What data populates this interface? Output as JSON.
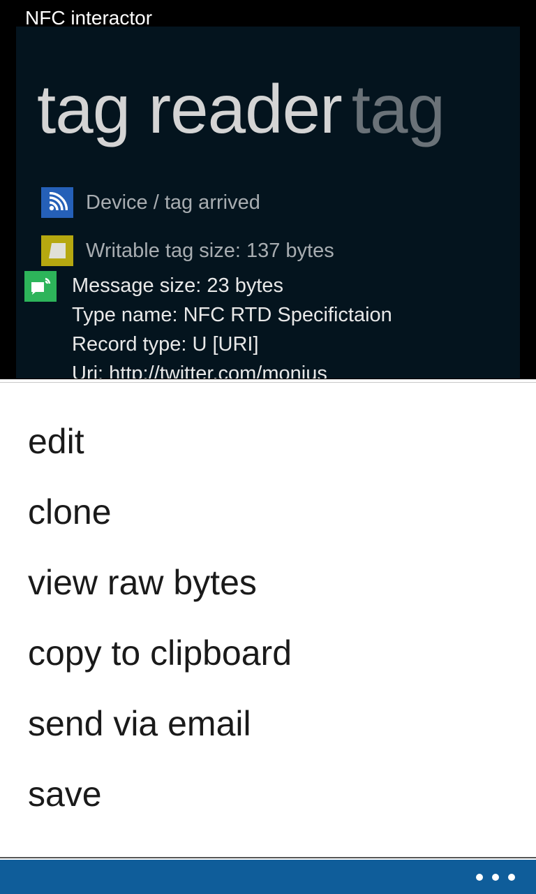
{
  "app": {
    "title": "NFC interactor"
  },
  "panorama": {
    "title_active": "tag reader",
    "title_next": "tag",
    "events": [
      {
        "icon": "nfc-signal-icon",
        "text": "Device / tag arrived",
        "color": "#2560b8"
      },
      {
        "icon": "tag-icon",
        "text": "Writable tag size: 137 bytes",
        "color": "#b6a810"
      }
    ],
    "message": {
      "icon": "message-icon",
      "color": "#2db45a",
      "lines": [
        "Message size: 23 bytes",
        "Type name: NFC RTD Specifictaion",
        "Record type: U [URI]",
        "Uri: http://twitter.com/monius"
      ]
    }
  },
  "menu": {
    "items": [
      "edit",
      "clone",
      "view raw bytes",
      "copy to clipboard",
      "send via email",
      "save"
    ]
  },
  "app_bar": {
    "more_icon": "ellipsis-icon",
    "color": "#0f5d9a"
  }
}
